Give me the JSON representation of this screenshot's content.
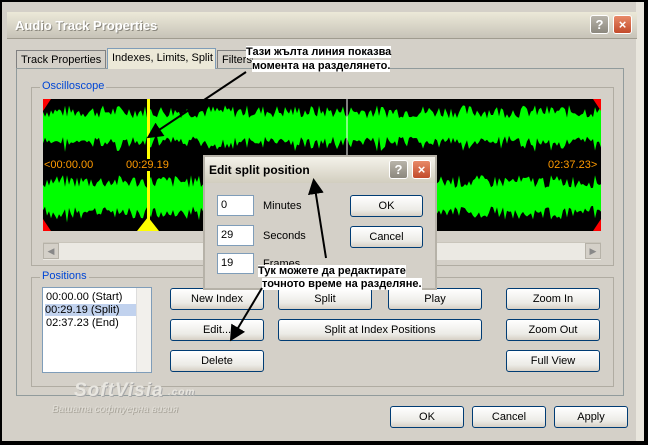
{
  "window": {
    "title": "Audio Track Properties",
    "help_label": "?",
    "close_label": "×"
  },
  "tabs": [
    "Track Properties",
    "Indexes, Limits, Split",
    "Filters"
  ],
  "oscilloscope": {
    "label": "Oscilloscope",
    "start_time": "<00:00.00",
    "split_time": "00:29.19",
    "end_time": "02:37.23>",
    "wave_color": "#00ff00",
    "marker_color": "#ffff00",
    "limit_color": "#ff0000"
  },
  "positions": {
    "label": "Positions",
    "items": [
      "00:00.00 (Start)",
      "00:29.19 (Split)",
      "02:37.23 (End)"
    ],
    "selected_index": 1
  },
  "buttons": {
    "new_index": "New Index",
    "split": "Split",
    "play": "Play",
    "zoom_in": "Zoom In",
    "edit": "Edit...",
    "split_at_index": "Split at Index Positions",
    "zoom_out": "Zoom Out",
    "delete": "Delete",
    "full_view": "Full View"
  },
  "footer": {
    "ok": "OK",
    "cancel": "Cancel",
    "apply": "Apply"
  },
  "split_dialog": {
    "title": "Edit split position",
    "help_label": "?",
    "close_label": "×",
    "minutes_value": "0",
    "minutes_label": "Minutes",
    "seconds_value": "29",
    "seconds_label": "Seconds",
    "frames_value": "19",
    "frames_label": "Frames",
    "ok": "OK",
    "cancel": "Cancel"
  },
  "annotations": {
    "yellow_line_line1": "Тази жълта линия показва",
    "yellow_line_line2": "момента на разделянето.",
    "edit_line1": "Тук можете да редактирате",
    "edit_line2": "точното време на разделяне."
  },
  "watermark": {
    "brand": "SoftVisia",
    "tagline": "Вашата софтуерна визия",
    "suffix": ".com"
  }
}
